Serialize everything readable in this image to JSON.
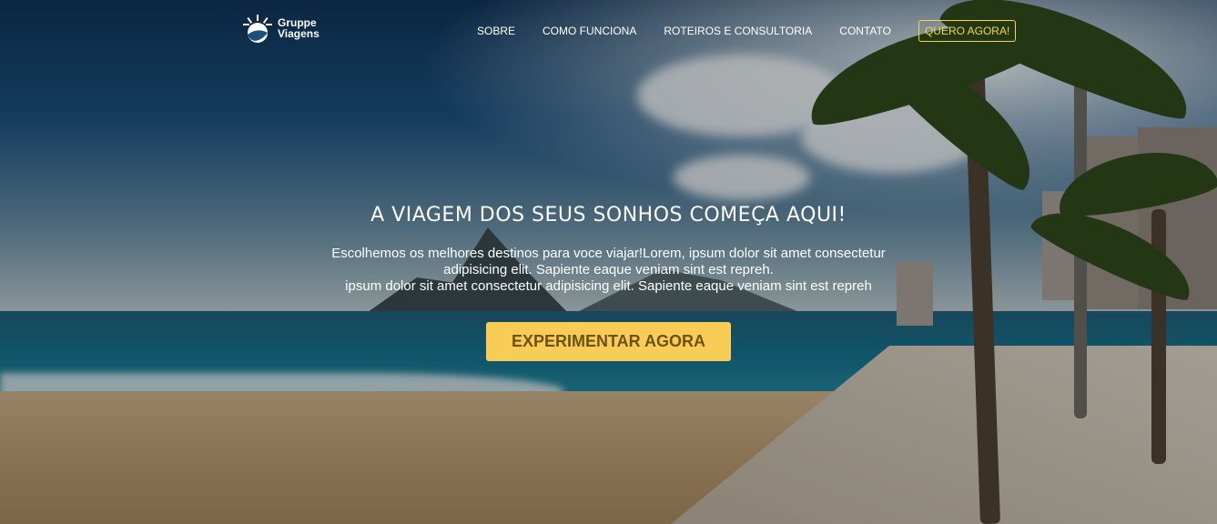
{
  "brand": {
    "line1": "Gruppe",
    "line2": "Viagens",
    "logo_icon": "sun-wave-logo-icon"
  },
  "nav": {
    "items": [
      {
        "label": "SOBRE"
      },
      {
        "label": "COMO FUNCIONA"
      },
      {
        "label": "ROTEIROS E CONSULTORIA"
      },
      {
        "label": "CONTATO"
      }
    ],
    "cta_label": "QUERO AGORA!"
  },
  "hero": {
    "title": "A VIAGEM DOS SEUS SONHOS COMEÇA AQUI!",
    "desc_line1": "Escolhemos os melhores destinos para voce viajar!Lorem, ipsum dolor sit amet consectetur",
    "desc_line2": "adipisicing elit. Sapiente eaque veniam sint est repreh.",
    "desc_line3": "ipsum dolor sit amet consectetur adipisicing elit. Sapiente eaque veniam sint est repreh",
    "button_label": "EXPERIMENTAR AGORA"
  },
  "colors": {
    "accent": "#f9cd55",
    "nav_cta": "#f4d93c",
    "button_text": "#6b5217"
  }
}
